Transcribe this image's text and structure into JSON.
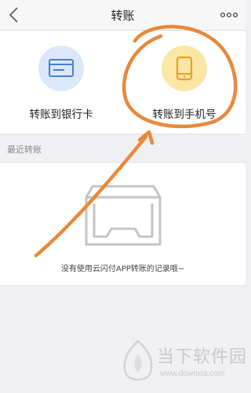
{
  "nav": {
    "title": "转账"
  },
  "actions": [
    {
      "label": "转账到银行卡",
      "icon": "bank-card-icon",
      "color": "#4a7fd1"
    },
    {
      "label": "转账到手机号",
      "icon": "mobile-phone-icon",
      "color": "#e8a21a"
    }
  ],
  "recent": {
    "header": "最近转账",
    "empty_icon": "empty-tray-icon",
    "empty_text": "没有使用云闪付APP转账的记录哦~"
  },
  "watermark": {
    "name": "当下软件园",
    "url": "www.downxia.com"
  },
  "colors": {
    "annotation": "#e8893a",
    "accent_blue": "#4a7fd1",
    "accent_yellow": "#f2b53a"
  }
}
